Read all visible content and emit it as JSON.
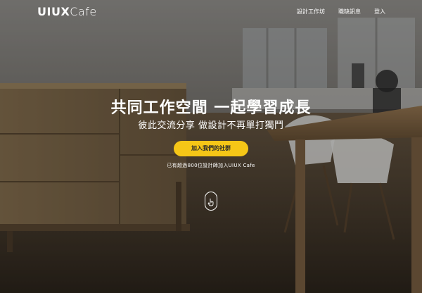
{
  "navbar": {
    "logo_part1": "UIUX",
    "logo_part2": "Cafe",
    "links": [
      "設計工作坊",
      "職缺訊息",
      "登入"
    ]
  },
  "hero": {
    "title": "共同工作空間 一起學習成長",
    "subtitle": "彼此交流分享 做設計不再單打獨鬥",
    "cta_label": "加入我們的社群",
    "member_note": "已有超過800位設計師加入UIUX Cafe",
    "scroll_icon": "hand-pointer-icon"
  },
  "colors": {
    "accent": "#f5c617",
    "text": "#ffffff",
    "cta_text": "#2a2a2a"
  }
}
